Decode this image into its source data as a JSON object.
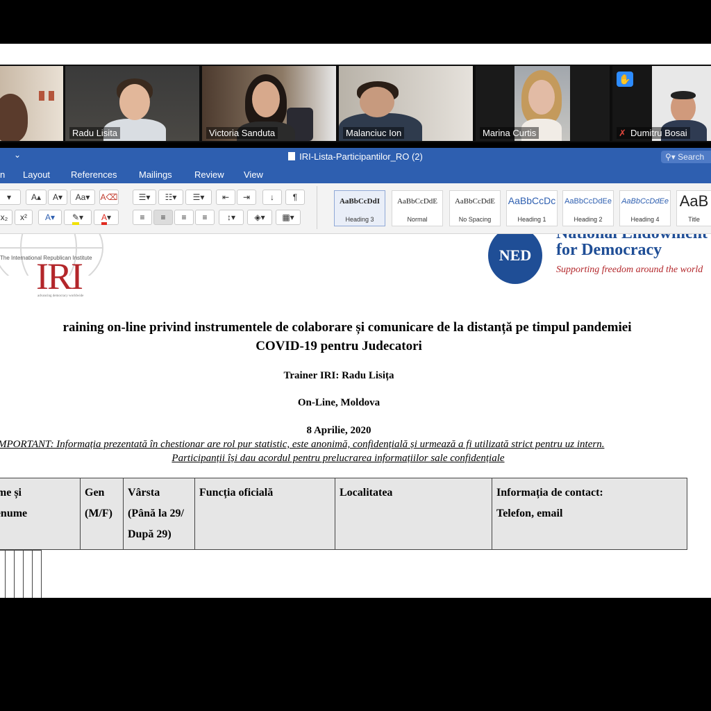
{
  "zoom": {
    "participants": [
      {
        "name": ""
      },
      {
        "name": "Radu Lisita"
      },
      {
        "name": "Victoria Sanduta"
      },
      {
        "name": "Malanciuc Ion"
      },
      {
        "name": "Marina Curtis"
      },
      {
        "name": "Dumitru Bosai"
      }
    ]
  },
  "word": {
    "document_title": "IRI-Lista-Participantilor_RO (2)",
    "search_placeholder": "Search",
    "tabs": [
      "n",
      "Layout",
      "References",
      "Mailings",
      "Review",
      "View"
    ],
    "styles": [
      {
        "sample": "AaBbCcDdI",
        "name": "Heading 3"
      },
      {
        "sample": "AaBbCcDdE",
        "name": "Normal"
      },
      {
        "sample": "AaBbCcDdE",
        "name": "No Spacing"
      },
      {
        "sample": "AaBbCcDc",
        "name": "Heading 1"
      },
      {
        "sample": "AaBbCcDdEe",
        "name": "Heading 2"
      },
      {
        "sample": "AaBbCcDdEe",
        "name": "Heading 4"
      },
      {
        "sample": "AaB",
        "name": "Title"
      }
    ]
  },
  "document": {
    "iri_logo": {
      "tagline": "The International Republican Institute",
      "mark": "IRI",
      "sub": "advancing democracy worldwide"
    },
    "ned_logo": {
      "mark": "NED",
      "line1": "National Endowment",
      "line2": "for Democracy",
      "line3": "Supporting freedom around the world"
    },
    "heading_line1": "raining on-line privind instrumentele de colaborare și comunicare de la distanță pe timpul pandemiei",
    "heading_line2": "COVID-19 pentru Judecatori",
    "trainer": "Trainer IRI: Radu Lisița",
    "location": "On-Line, Moldova",
    "date": "8 Aprilie, 2020",
    "notice_line1": "MPORTANT: Informația prezentată în chestionar are rol pur statistic, este anonimă, confidențială și urmează a fi utilizată strict pentru uz intern.",
    "notice_line2": "Participanții își dau acordul pentru prelucrarea informațiilor sale confidențiale",
    "table_headers": [
      {
        "l1": "ume și",
        "l2": "renume",
        "l3": ""
      },
      {
        "l1": "Gen",
        "l2": "(M/F)",
        "l3": ""
      },
      {
        "l1": "Vârsta",
        "l2": "(Până la 29/",
        "l3": "După 29)"
      },
      {
        "l1": "Funcția oficială",
        "l2": "",
        "l3": ""
      },
      {
        "l1": "Localitatea",
        "l2": "",
        "l3": ""
      },
      {
        "l1": "Informația de contact:",
        "l2": "Telefon,  email",
        "l3": ""
      }
    ]
  },
  "colors": {
    "word_blue": "#2e5fb0",
    "iri_red": "#b3262a",
    "ned_blue": "#1f4e96"
  }
}
